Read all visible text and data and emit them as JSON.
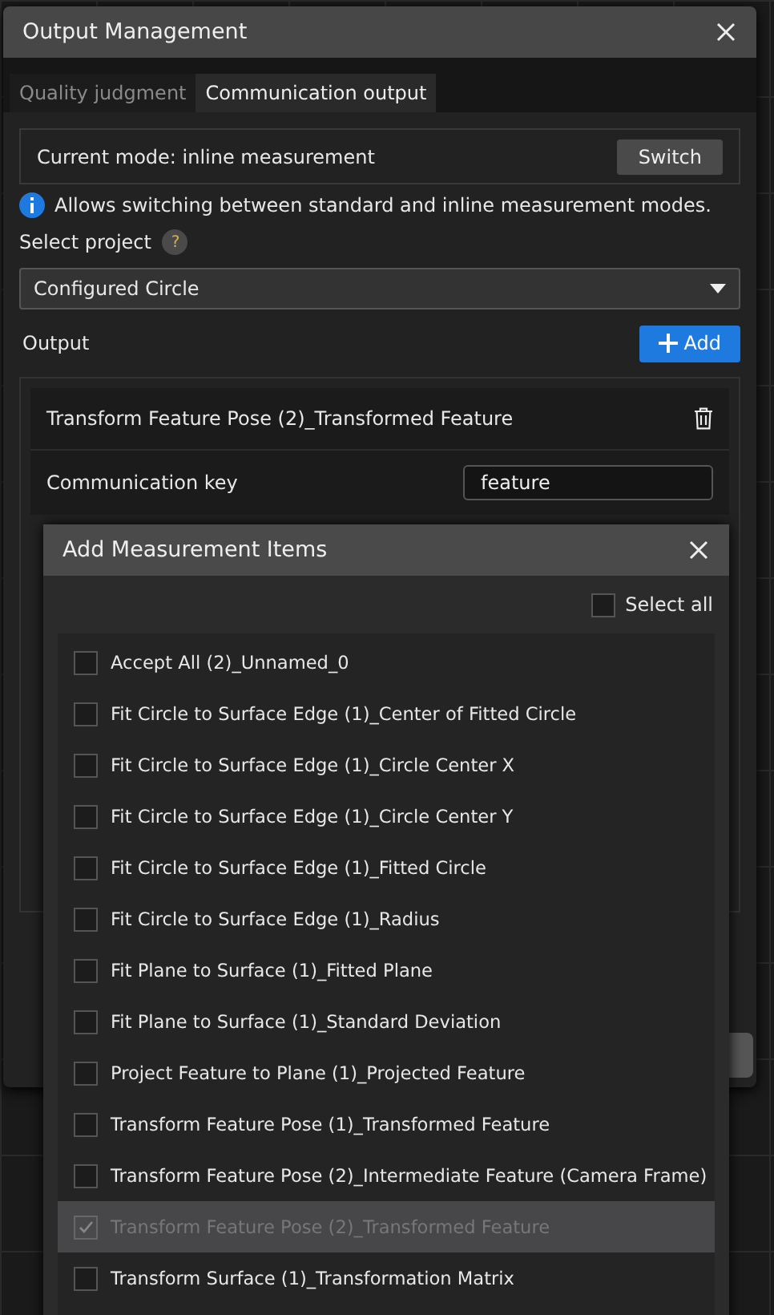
{
  "window": {
    "title": "Output Management"
  },
  "tabs": [
    {
      "label": "Quality judgment",
      "selected": false
    },
    {
      "label": "Communication output",
      "selected": true
    }
  ],
  "mode": {
    "text": "Current mode: inline measurement",
    "button": "Switch"
  },
  "info": "Allows switching between standard and inline measurement modes.",
  "project": {
    "label": "Select project",
    "help": "?",
    "value": "Configured Circle"
  },
  "output": {
    "label": "Output",
    "add_button": "Add",
    "item": {
      "title": "Transform Feature Pose (2)_Transformed Feature",
      "key_label": "Communication key",
      "key_value": "feature"
    }
  },
  "dialog": {
    "title": "Add Measurement Items",
    "select_all": {
      "label": "Select all",
      "checked": false
    },
    "items": [
      {
        "label": "Accept All (2)_Unnamed_0",
        "checked": false,
        "disabled": false
      },
      {
        "label": "Fit Circle to Surface Edge (1)_Center of Fitted Circle",
        "checked": false,
        "disabled": false
      },
      {
        "label": "Fit Circle to Surface Edge (1)_Circle Center X",
        "checked": false,
        "disabled": false
      },
      {
        "label": "Fit Circle to Surface Edge (1)_Circle Center Y",
        "checked": false,
        "disabled": false
      },
      {
        "label": "Fit Circle to Surface Edge (1)_Fitted Circle",
        "checked": false,
        "disabled": false
      },
      {
        "label": "Fit Circle to Surface Edge (1)_Radius",
        "checked": false,
        "disabled": false
      },
      {
        "label": "Fit Plane to Surface (1)_Fitted Plane",
        "checked": false,
        "disabled": false
      },
      {
        "label": "Fit Plane to Surface (1)_Standard Deviation",
        "checked": false,
        "disabled": false
      },
      {
        "label": "Project Feature to Plane (1)_Projected Feature",
        "checked": false,
        "disabled": false
      },
      {
        "label": "Transform Feature Pose (1)_Transformed Feature",
        "checked": false,
        "disabled": false
      },
      {
        "label": "Transform Feature Pose (2)_Intermediate Feature (Camera Frame)",
        "checked": false,
        "disabled": false
      },
      {
        "label": "Transform Feature Pose (2)_Transformed Feature",
        "checked": true,
        "disabled": true
      },
      {
        "label": "Transform Surface (1)_Transformation Matrix",
        "checked": false,
        "disabled": false
      }
    ]
  }
}
